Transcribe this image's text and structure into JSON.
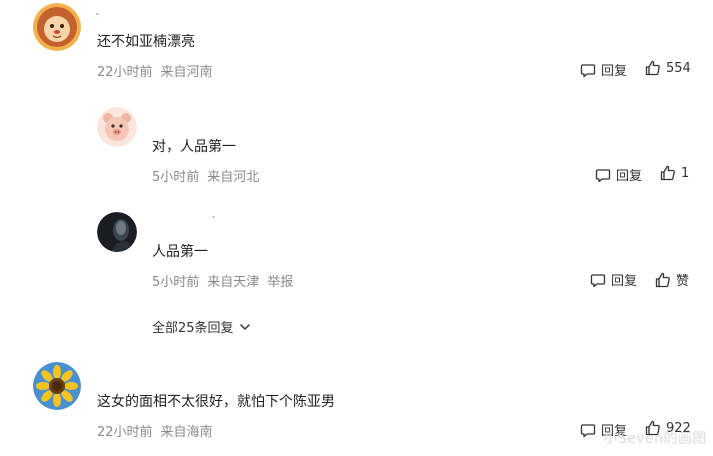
{
  "comments": [
    {
      "text": "还不如亚楠漂亮",
      "time": "22小时前",
      "location": "来自河南",
      "report": "",
      "reply_label": "回复",
      "like_label": "554",
      "avatar": "lion-avatar"
    },
    {
      "text": "对，人品第一",
      "time": "5小时前",
      "location": "来自河北",
      "report": "",
      "reply_label": "回复",
      "like_label": "1",
      "avatar": "cartoon-pig-avatar"
    },
    {
      "text": "人品第一",
      "time": "5小时前",
      "location": "来自天津",
      "report": "举报",
      "reply_label": "回复",
      "like_label": "赞",
      "avatar": "dark-figure-avatar"
    },
    {
      "text": "这女的面相不太很好，就怕下个陈亚男",
      "time": "22小时前",
      "location": "来自海南",
      "report": "",
      "reply_label": "回复",
      "like_label": "922",
      "avatar": "sunflower-avatar"
    }
  ],
  "expand_replies": "全部25条回复",
  "watermark": "小Seven的画图",
  "colors": {
    "text": "#222222",
    "meta": "#8a8a8a",
    "background": "#ffffff"
  }
}
